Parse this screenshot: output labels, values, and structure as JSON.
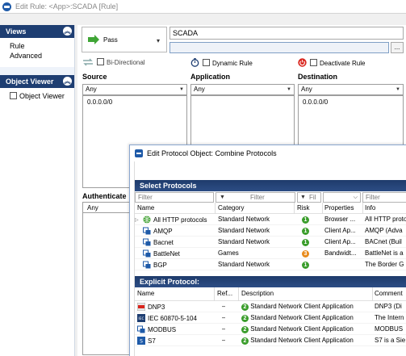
{
  "window": {
    "title": "Edit Rule: <App>:SCADA [Rule]"
  },
  "left": {
    "views": {
      "title": "Views",
      "items": [
        "Rule",
        "Advanced"
      ]
    },
    "object_viewer": {
      "title": "Object Viewer",
      "checkbox_label": "Object Viewer"
    }
  },
  "rule": {
    "action": "Pass",
    "name": "SCADA",
    "comment": "",
    "dots": "...",
    "options": {
      "bidirectional": "Bi-Directional",
      "dynamic": "Dynamic Rule",
      "deactivate": "Deactivate Rule"
    },
    "columns": {
      "source": {
        "title": "Source",
        "selector": "Any",
        "items": [
          "0.0.0.0/0"
        ]
      },
      "application": {
        "title": "Application",
        "selector": "Any"
      },
      "destination": {
        "title": "Destination",
        "selector": "Any",
        "items": [
          "0.0.0.0/0"
        ]
      }
    },
    "authentication": {
      "title": "Authenticate",
      "selector": "Any"
    }
  },
  "dialog": {
    "title": "Edit Protocol Object: Combine Protocols",
    "select_protocols": {
      "title": "Select Protocols",
      "filters": [
        "Filter",
        "Filter",
        "Fil",
        "",
        "Filter"
      ],
      "headers": [
        "Name",
        "Category",
        "Risk",
        "Properties",
        "Info"
      ],
      "rows": [
        {
          "name": "All HTTP protocols",
          "category": "Standard Network",
          "risk": "1",
          "risk_color": "#3a9d2b",
          "properties": "Browser ...",
          "info": "All HTTP proto",
          "icon": "globe-icon"
        },
        {
          "name": "AMQP",
          "category": "Standard Network",
          "risk": "1",
          "risk_color": "#3a9d2b",
          "properties": "Client Ap...",
          "info": "AMQP (Adva",
          "icon": "protocol-icon"
        },
        {
          "name": "Bacnet",
          "category": "Standard Network",
          "risk": "1",
          "risk_color": "#3a9d2b",
          "properties": "Client Ap...",
          "info": "BACnet (Buil",
          "icon": "protocol-icon"
        },
        {
          "name": "BattleNet",
          "category": "Games",
          "risk": "3",
          "risk_color": "#e88a1a",
          "properties": "Bandwidt...",
          "info": "BattleNet is a",
          "icon": "protocol-icon"
        },
        {
          "name": "BGP",
          "category": "Standard Network",
          "risk": "1",
          "risk_color": "#3a9d2b",
          "properties": "",
          "info": "The Border G",
          "icon": "protocol-icon"
        }
      ]
    },
    "explicit_protocol": {
      "title": "Explicit Protocol:",
      "headers": [
        "Name",
        "Ref...",
        "Description",
        "Comment"
      ],
      "rows": [
        {
          "name": "DNP3",
          "ref": "–",
          "risk": "2",
          "description": "Standard Network Client Application",
          "comment": "DNP3 (Di",
          "icon": "dnp3-icon"
        },
        {
          "name": "IEC 60870-5-104",
          "ref": "–",
          "risk": "2",
          "description": "Standard Network Client Application",
          "comment": "The Intern",
          "icon": "iec-icon"
        },
        {
          "name": "MODBUS",
          "ref": "–",
          "risk": "2",
          "description": "Standard Network Client Application",
          "comment": "MODBUS",
          "icon": "protocol-icon"
        },
        {
          "name": "S7",
          "ref": "–",
          "risk": "2",
          "description": "Standard Network Client Application",
          "comment": "S7 is a Sie",
          "icon": "s7-icon"
        }
      ]
    }
  },
  "colors": {
    "header_navy": "#1e3e72",
    "risk_green": "#3a9d2b",
    "risk_orange": "#e88a1a",
    "accent_blue": "#1e5aa8"
  }
}
